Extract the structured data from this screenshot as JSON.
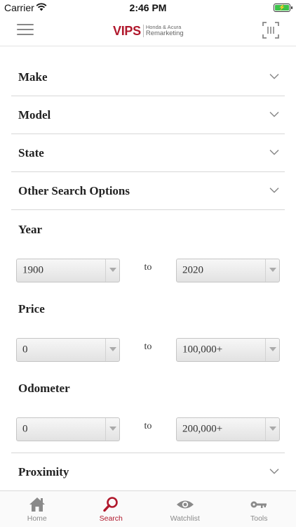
{
  "status": {
    "carrier": "Carrier",
    "time": "2:46 PM"
  },
  "header": {
    "logo_main": "VIPS",
    "logo_sub_top": "Honda & Acura",
    "logo_sub_bottom": "Remarketing"
  },
  "filters": {
    "make": "Make",
    "model": "Model",
    "state": "State",
    "other": "Other Search Options",
    "proximity": "Proximity"
  },
  "year": {
    "label": "Year",
    "from": "1900",
    "to_word": "to",
    "to": "2020"
  },
  "price": {
    "label": "Price",
    "from": "0",
    "to_word": "to",
    "to": "100,000+"
  },
  "odometer": {
    "label": "Odometer",
    "from": "0",
    "to_word": "to",
    "to": "200,000+"
  },
  "tabs": [
    {
      "label": "Home",
      "icon": "home-icon"
    },
    {
      "label": "Search",
      "icon": "search-icon",
      "active": true
    },
    {
      "label": "Watchlist",
      "icon": "eye-icon"
    },
    {
      "label": "Tools",
      "icon": "key-icon"
    }
  ],
  "colors": {
    "brand": "#b0182c",
    "battery": "#3cc24a"
  }
}
